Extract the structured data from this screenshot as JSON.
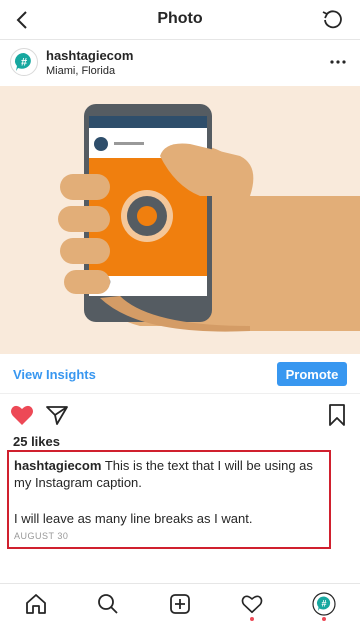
{
  "header": {
    "title": "Photo",
    "back_icon": "chevron-left-icon",
    "refresh_icon": "refresh-icon"
  },
  "post": {
    "username": "hashtagiecom",
    "location": "Miami, Florida",
    "avatar_icon": "hashtag-avatar-icon",
    "more_icon": "more-icon"
  },
  "insights": {
    "view_insights_label": "View Insights",
    "promote_label": "Promote"
  },
  "actions": {
    "like_icon": "heart-icon",
    "share_icon": "paper-plane-icon",
    "save_icon": "bookmark-icon",
    "liked": true
  },
  "likes": "25 likes",
  "caption": {
    "username": "hashtagiecom",
    "text": "This is the text that I will be using as my Instagram caption.",
    "text2": "I will leave as many line breaks as I want.",
    "date": "AUGUST 30"
  },
  "bottom_nav": [
    "home-icon",
    "search-icon",
    "add-icon",
    "activity-icon",
    "profile-icon"
  ],
  "colors": {
    "accent": "#3897f0",
    "like": "#ed4956",
    "highlight_border": "#d0202e",
    "brand_teal": "#17a8a0",
    "image_bg": "#f9eadb",
    "phone_screen": "#f07f0e"
  }
}
